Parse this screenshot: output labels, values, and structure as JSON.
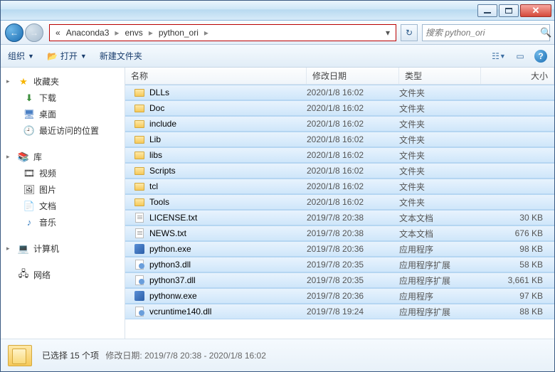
{
  "breadcrumb": {
    "prefix": "«",
    "seg1": "Anaconda3",
    "seg2": "envs",
    "seg3": "python_ori"
  },
  "search": {
    "placeholder": "搜索 python_ori"
  },
  "toolbar": {
    "organize": "组织",
    "open": "打开",
    "newfolder": "新建文件夹"
  },
  "sidebar": {
    "favorites": "收藏夹",
    "downloads": "下载",
    "desktop": "桌面",
    "recent": "最近访问的位置",
    "libraries": "库",
    "videos": "视频",
    "pictures": "图片",
    "documents": "文档",
    "music": "音乐",
    "computer": "计算机",
    "network": "网络"
  },
  "columns": {
    "name": "名称",
    "date": "修改日期",
    "type": "类型",
    "size": "大小"
  },
  "files": [
    {
      "name": "DLLs",
      "date": "2020/1/8 16:02",
      "type": "文件夹",
      "size": "",
      "icon": "folder"
    },
    {
      "name": "Doc",
      "date": "2020/1/8 16:02",
      "type": "文件夹",
      "size": "",
      "icon": "folder"
    },
    {
      "name": "include",
      "date": "2020/1/8 16:02",
      "type": "文件夹",
      "size": "",
      "icon": "folder"
    },
    {
      "name": "Lib",
      "date": "2020/1/8 16:02",
      "type": "文件夹",
      "size": "",
      "icon": "folder"
    },
    {
      "name": "libs",
      "date": "2020/1/8 16:02",
      "type": "文件夹",
      "size": "",
      "icon": "folder"
    },
    {
      "name": "Scripts",
      "date": "2020/1/8 16:02",
      "type": "文件夹",
      "size": "",
      "icon": "folder"
    },
    {
      "name": "tcl",
      "date": "2020/1/8 16:02",
      "type": "文件夹",
      "size": "",
      "icon": "folder"
    },
    {
      "name": "Tools",
      "date": "2020/1/8 16:02",
      "type": "文件夹",
      "size": "",
      "icon": "folder"
    },
    {
      "name": "LICENSE.txt",
      "date": "2019/7/8 20:38",
      "type": "文本文档",
      "size": "30 KB",
      "icon": "txt"
    },
    {
      "name": "NEWS.txt",
      "date": "2019/7/8 20:38",
      "type": "文本文档",
      "size": "676 KB",
      "icon": "txt"
    },
    {
      "name": "python.exe",
      "date": "2019/7/8 20:36",
      "type": "应用程序",
      "size": "98 KB",
      "icon": "exe"
    },
    {
      "name": "python3.dll",
      "date": "2019/7/8 20:35",
      "type": "应用程序扩展",
      "size": "58 KB",
      "icon": "dll"
    },
    {
      "name": "python37.dll",
      "date": "2019/7/8 20:35",
      "type": "应用程序扩展",
      "size": "3,661 KB",
      "icon": "dll"
    },
    {
      "name": "pythonw.exe",
      "date": "2019/7/8 20:36",
      "type": "应用程序",
      "size": "97 KB",
      "icon": "exe"
    },
    {
      "name": "vcruntime140.dll",
      "date": "2019/7/8 19:24",
      "type": "应用程序扩展",
      "size": "88 KB",
      "icon": "dll"
    }
  ],
  "status": {
    "main": "已选择 15 个项",
    "label": "修改日期:",
    "value": "2019/7/8 20:38 - 2020/1/8 16:02"
  }
}
